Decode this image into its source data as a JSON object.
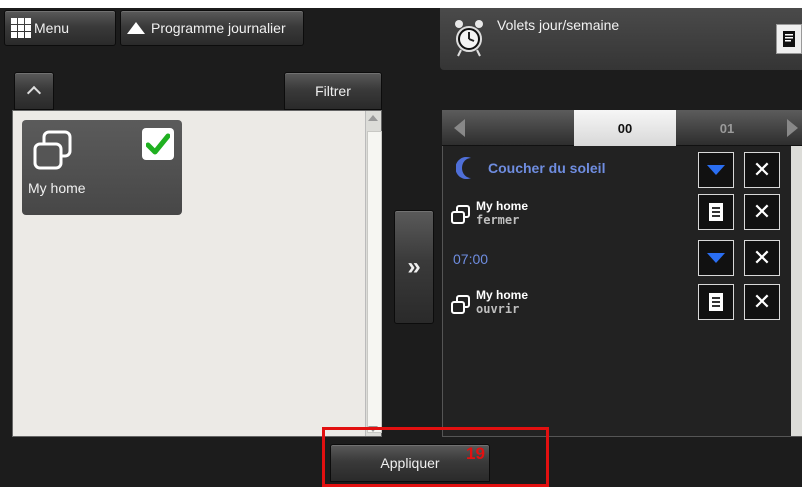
{
  "header": {
    "menu_label": "Menu",
    "program_label": "Programme journalier"
  },
  "top_right": {
    "title": "Volets jour/semaine"
  },
  "left": {
    "filter_label": "Filtrer",
    "tiles": [
      {
        "label": "My home",
        "checked": true
      }
    ]
  },
  "schedule": {
    "tabs": [
      "00",
      "01"
    ],
    "active_tab": "00",
    "rows": [
      {
        "type": "trigger",
        "icon": "moon-icon",
        "label": "Coucher du soleil",
        "color": "#6f8de0"
      },
      {
        "type": "action",
        "name": "My home",
        "action": "fermer"
      },
      {
        "type": "time",
        "label": "07:00",
        "color": "#6f8de0"
      },
      {
        "type": "action",
        "name": "My home",
        "action": "ouvrir"
      }
    ]
  },
  "footer": {
    "apply_label": "Appliquer",
    "annotation_number": "19",
    "annotation_color": "#e21010"
  }
}
